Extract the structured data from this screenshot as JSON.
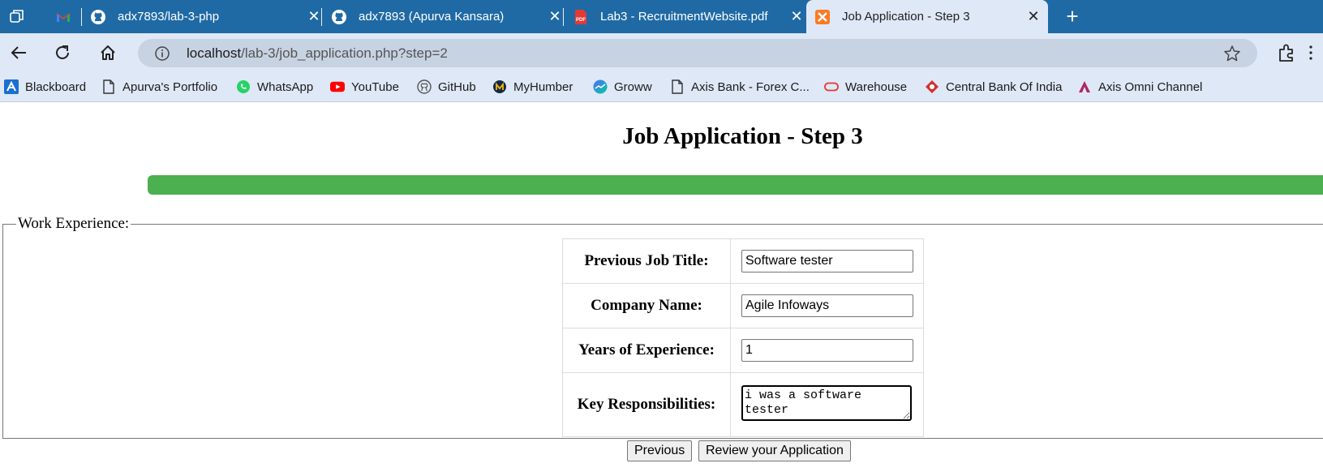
{
  "tabs": [
    {
      "title": "",
      "favicon": "gmail-icon"
    },
    {
      "title": "adx7893/lab-3-php",
      "favicon": "github-icon"
    },
    {
      "title": "adx7893 (Apurva Kansara)",
      "favicon": "github-icon"
    },
    {
      "title": "Lab3 - RecruitmentWebsite.pdf",
      "favicon": "pdf-icon"
    },
    {
      "title": "Job Application - Step 3",
      "favicon": "xampp-icon",
      "active": true
    }
  ],
  "address_bar": {
    "host": "localhost",
    "path": "/lab-3/job_application.php?step=2"
  },
  "bookmarks": [
    {
      "label": "Blackboard",
      "icon": "blackboard-icon"
    },
    {
      "label": "Apurva's Portfolio",
      "icon": "page-icon"
    },
    {
      "label": "WhatsApp",
      "icon": "whatsapp-icon"
    },
    {
      "label": "YouTube",
      "icon": "youtube-icon"
    },
    {
      "label": "GitHub",
      "icon": "github-icon"
    },
    {
      "label": "MyHumber",
      "icon": "myhumber-icon"
    },
    {
      "label": "Groww",
      "icon": "groww-icon"
    },
    {
      "label": "Axis Bank - Forex C...",
      "icon": "page-icon"
    },
    {
      "label": "Warehouse",
      "icon": "warehouse-icon"
    },
    {
      "label": "Central Bank Of India",
      "icon": "central-bank-icon"
    },
    {
      "label": "Axis Omni Channel",
      "icon": "axis-icon"
    }
  ],
  "page": {
    "title": "Job Application - Step 3",
    "progress_fraction": 1.0,
    "progress_color": "#4caf50",
    "fieldset_legend": "Work Experience:",
    "fields": {
      "previous_job_title": {
        "label": "Previous Job Title:",
        "value": "Software tester"
      },
      "company_name": {
        "label": "Company Name:",
        "value": "Agile Infoways"
      },
      "years_experience": {
        "label": "Years of Experience:",
        "value": "1"
      },
      "key_responsibilities": {
        "label": "Key Responsibilities:",
        "value": "i was a software tester"
      }
    },
    "buttons": {
      "previous": "Previous",
      "review": "Review your Application"
    }
  },
  "colors": {
    "tabstrip": "#1f6aa5",
    "toolbar": "#dfe8f6",
    "omnibox": "#c7d3e2"
  }
}
